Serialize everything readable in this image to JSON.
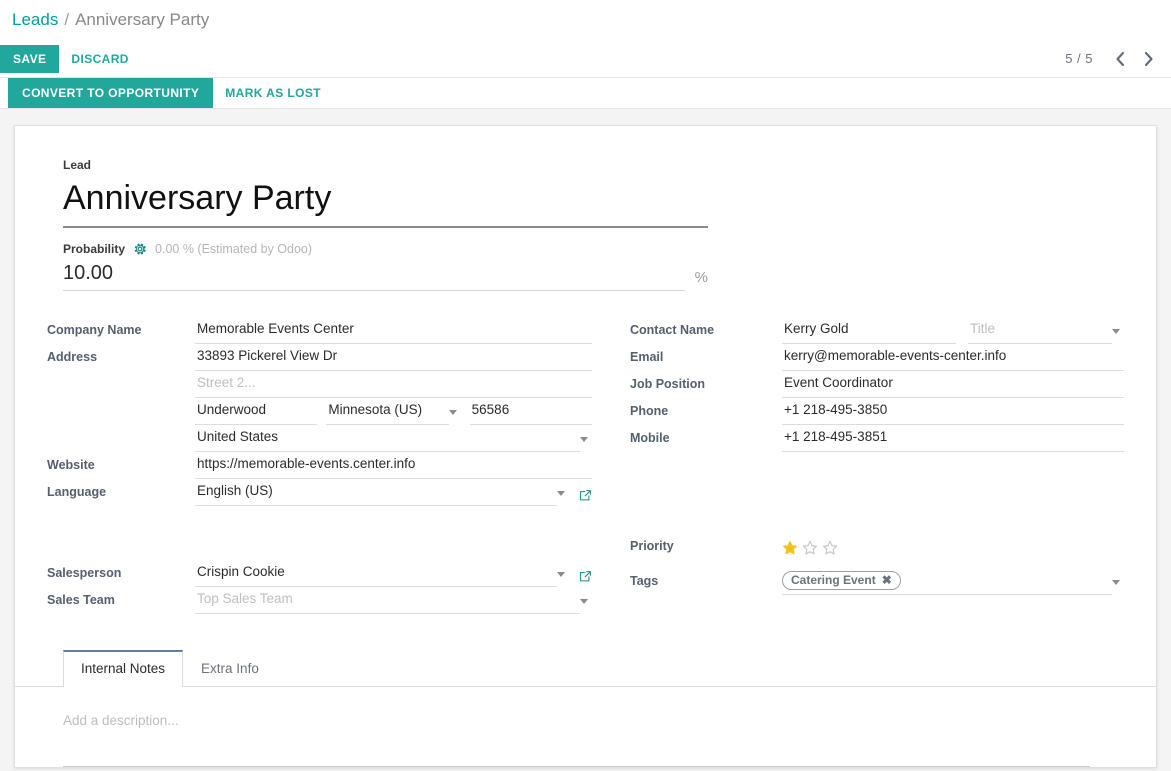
{
  "breadcrumb": {
    "root": "Leads",
    "separator": "/",
    "current": "Anniversary Party"
  },
  "control_panel": {
    "save_label": "SAVE",
    "discard_label": "DISCARD",
    "pager_count": "5 / 5",
    "prev_icon": "chevron-left-icon",
    "next_icon": "chevron-right-icon"
  },
  "action_bar": {
    "convert_label": "CONVERT TO OPPORTUNITY",
    "lost_label": "MARK AS LOST"
  },
  "form": {
    "lead_label": "Lead",
    "title": "Anniversary Party",
    "probability": {
      "label": "Probability",
      "gear_icon": "gear-icon",
      "estimated_text": "0.00 % (Estimated by Odoo)",
      "value": "10.00",
      "suffix": "%"
    },
    "left_fields": {
      "company_name_label": "Company Name",
      "company_name_value": "Memorable Events Center",
      "address_label": "Address",
      "street_value": "33893 Pickerel View Dr",
      "street2_placeholder": "Street 2...",
      "city_value": "Underwood",
      "state_value": "Minnesota (US)",
      "zip_value": "56586",
      "country_value": "United States",
      "website_label": "Website",
      "website_value": "https://memorable-events.center.info",
      "language_label": "Language",
      "language_value": "English (US)",
      "salesperson_label": "Salesperson",
      "salesperson_value": "Crispin Cookie",
      "sales_team_label": "Sales Team",
      "sales_team_placeholder": "Top Sales Team"
    },
    "right_fields": {
      "contact_name_label": "Contact Name",
      "contact_name_value": "Kerry Gold",
      "title_placeholder": "Title",
      "email_label": "Email",
      "email_value": "kerry@memorable-events-center.info",
      "job_position_label": "Job Position",
      "job_position_value": "Event Coordinator",
      "phone_label": "Phone",
      "phone_value": "+1 218-495-3850",
      "mobile_label": "Mobile",
      "mobile_value": "+1 218-495-3851",
      "priority_label": "Priority",
      "priority_filled": 1,
      "priority_total": 3,
      "tags_label": "Tags",
      "tag_value": "Catering Event",
      "tag_remove_icon": "close-icon"
    }
  },
  "notebook": {
    "tabs": [
      {
        "label": "Internal Notes",
        "active": true
      },
      {
        "label": "Extra Info",
        "active": false
      }
    ],
    "description_placeholder": "Add a description..."
  },
  "colors": {
    "accent_teal": "#21A79C",
    "link_teal": "#00A09D",
    "star_gold": "#F0C419",
    "tab_active_border": "#5c7ea8"
  }
}
